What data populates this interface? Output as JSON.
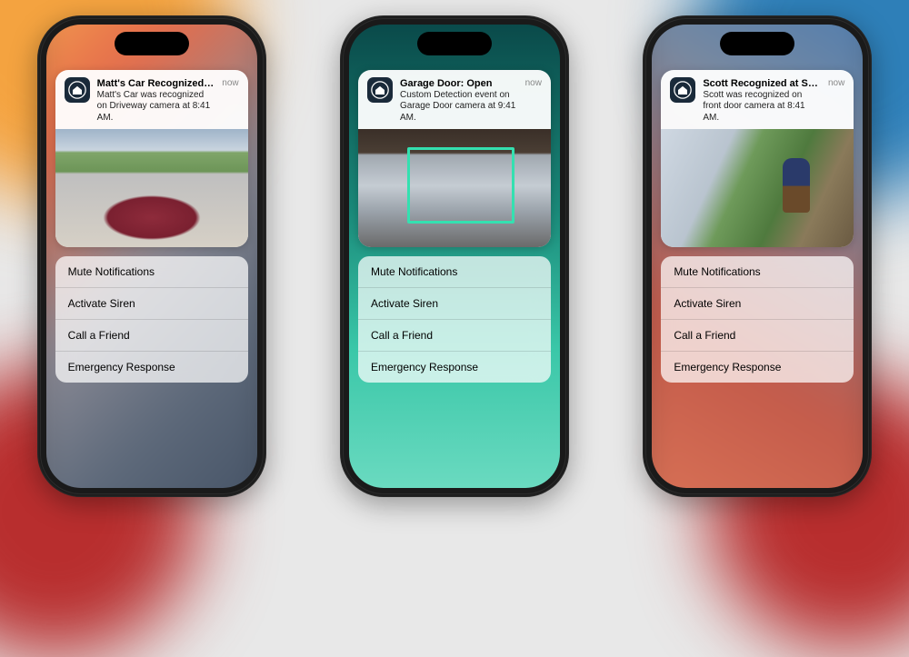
{
  "phones": [
    {
      "wallpaper": "wp-left",
      "thumb_class": "thumb-driveway",
      "notification": {
        "title": "Matt's Car Recognized at Smith H...",
        "body": "Matt's Car was recognized on Driveway camera at 8:41 AM.",
        "time": "now"
      },
      "actions": [
        "Mute Notifications",
        "Activate Siren",
        "Call a Friend",
        "Emergency Response"
      ]
    },
    {
      "wallpaper": "wp-center",
      "thumb_class": "thumb-garage",
      "detection_box": true,
      "notification": {
        "title": "Garage Door: Open",
        "body": "Custom Detection event on Garage Door camera at 9:41 AM.",
        "time": "now"
      },
      "actions": [
        "Mute Notifications",
        "Activate Siren",
        "Call a Friend",
        "Emergency Response"
      ]
    },
    {
      "wallpaper": "wp-right",
      "thumb_class": "thumb-door",
      "person": true,
      "notification": {
        "title": "Scott Recognized at Smith Home",
        "body": "Scott was recognized on front door camera at 8:41 AM.",
        "time": "now"
      },
      "actions": [
        "Mute Notifications",
        "Activate Siren",
        "Call a Friend",
        "Emergency Response"
      ]
    }
  ]
}
